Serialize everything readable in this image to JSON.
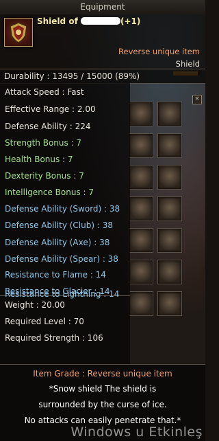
{
  "window": {
    "title": "Equipment"
  },
  "item": {
    "name_prefix": "Shield of",
    "enhancement": "(+1)",
    "rarity": "Reverse unique item",
    "type": "Shield",
    "durability_label": "Durability : 13495 / 15000 (89%)",
    "durability_fraction": 0.89
  },
  "stats": [
    {
      "text": "Attack Speed : Fast",
      "tone": "w"
    },
    {
      "text": "Effective Range : 2.00",
      "tone": "w"
    },
    {
      "text": "Defense Ability : 224",
      "tone": "w"
    },
    {
      "text": "Strength Bonus : 7",
      "tone": "g"
    },
    {
      "text": "Health Bonus : 7",
      "tone": "g"
    },
    {
      "text": "Dexterity Bonus : 7",
      "tone": "g"
    },
    {
      "text": "Intelligence Bonus : 7",
      "tone": "g"
    },
    {
      "text": "Defense Ability (Sword) : 38",
      "tone": "b"
    },
    {
      "text": "Defense Ability (Club) : 38",
      "tone": "b"
    },
    {
      "text": "Defense Ability (Axe) : 38",
      "tone": "b"
    },
    {
      "text": "Defense Ability (Spear) : 38",
      "tone": "b"
    },
    {
      "text": "Resistance to Flame : 14",
      "tone": "b"
    },
    {
      "text": "Resistance to Glacier : 14",
      "tone": "b"
    },
    {
      "text": "Resistance to Lightning : 14",
      "tone": "b"
    }
  ],
  "requirements": {
    "weight": "Weight : 20.00",
    "level": "Required Level : 70",
    "strength": "Required Strength : 106"
  },
  "footer": {
    "grade": "Item Grade : Reverse unique item",
    "desc_line1": "*Snow shield The shield is",
    "desc_line2": "surrounded by the curse of ice.",
    "desc_line3": "No attacks can easily penetrate that.*"
  },
  "watermark": "Windows u Etkinleş",
  "colors": {
    "rarity": "#f2a16a",
    "bonus": "#a5e08a",
    "resist": "#8fc7ea",
    "name": "#f3e8a8"
  },
  "icons": {
    "item": "shield-icon",
    "close": "close-icon"
  }
}
